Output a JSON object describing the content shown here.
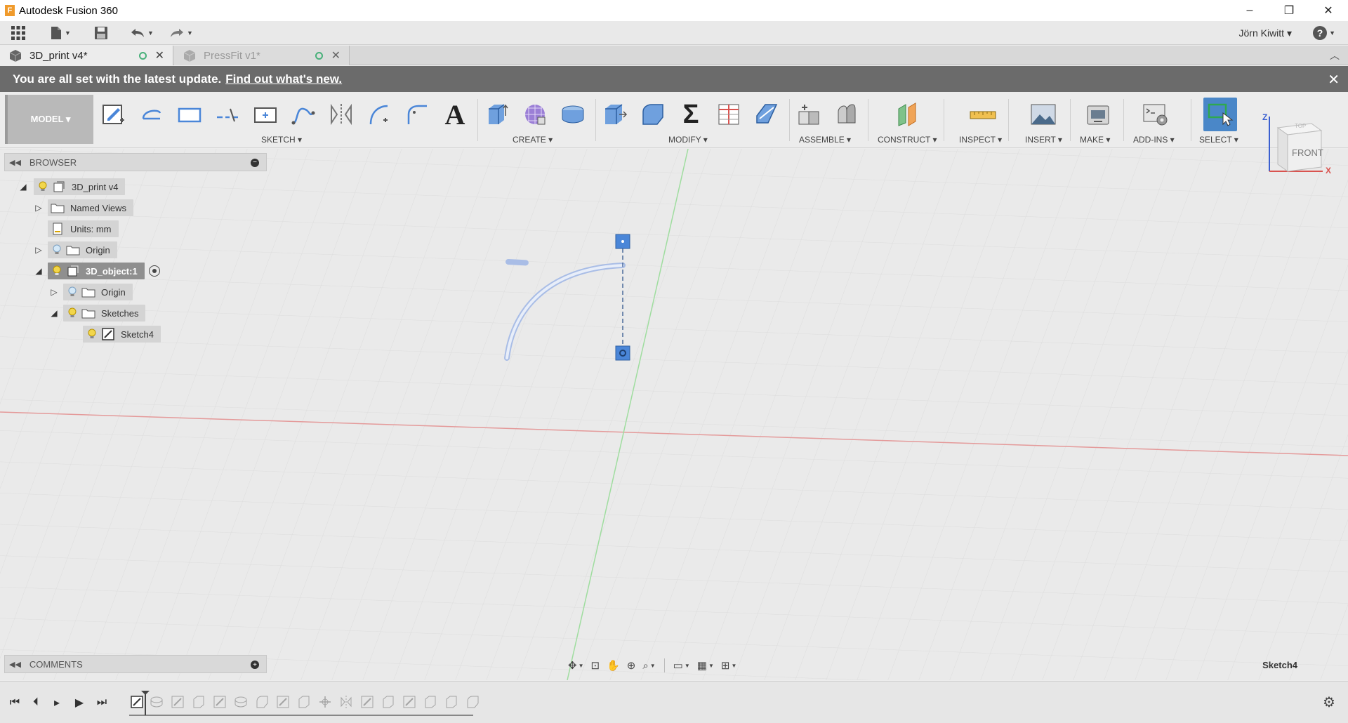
{
  "window": {
    "title": "Autodesk Fusion 360",
    "minimize_glyph": "–",
    "restore_glyph": "❐",
    "close_glyph": "✕"
  },
  "quick_access": {
    "user_name": "Jörn Kiwitt ▾",
    "help_glyph": "?"
  },
  "tabs": [
    {
      "label": "3D_print v4*",
      "active": true
    },
    {
      "label": "PressFit v1*",
      "active": false
    }
  ],
  "notification": {
    "text": "You are all set with the latest update.",
    "link": "Find out what's new."
  },
  "toolbar": {
    "workspace": "MODEL ▾",
    "groups": {
      "sketch": "SKETCH ▾",
      "create": "CREATE ▾",
      "modify": "MODIFY ▾",
      "assemble": "ASSEMBLE ▾",
      "construct": "CONSTRUCT ▾",
      "inspect": "INSPECT ▾",
      "insert": "INSERT ▾",
      "make": "MAKE ▾",
      "addins": "ADD-INS ▾",
      "select": "SELECT ▾"
    }
  },
  "viewcube": {
    "face_front": "FRONT",
    "face_top": "TOP",
    "axis_z": "Z",
    "axis_x": "X"
  },
  "browser": {
    "title": "BROWSER",
    "tree": [
      {
        "label": "3D_print v4"
      },
      {
        "label": "Named Views"
      },
      {
        "label": "Units: mm"
      },
      {
        "label": "Origin"
      },
      {
        "label": "3D_object:1"
      },
      {
        "label": "Origin"
      },
      {
        "label": "Sketches"
      },
      {
        "label": "Sketch4"
      }
    ]
  },
  "comments": {
    "title": "COMMENTS"
  },
  "status": {
    "active_sketch": "Sketch4"
  },
  "colors": {
    "x_axis": "#e06a6a",
    "y_axis": "#7dd47d",
    "sketch_curve": "#a9bde6",
    "sketch_point": "#4a86d8",
    "notice_bg": "#6b6b6b",
    "select_accent": "#4a87c8"
  }
}
